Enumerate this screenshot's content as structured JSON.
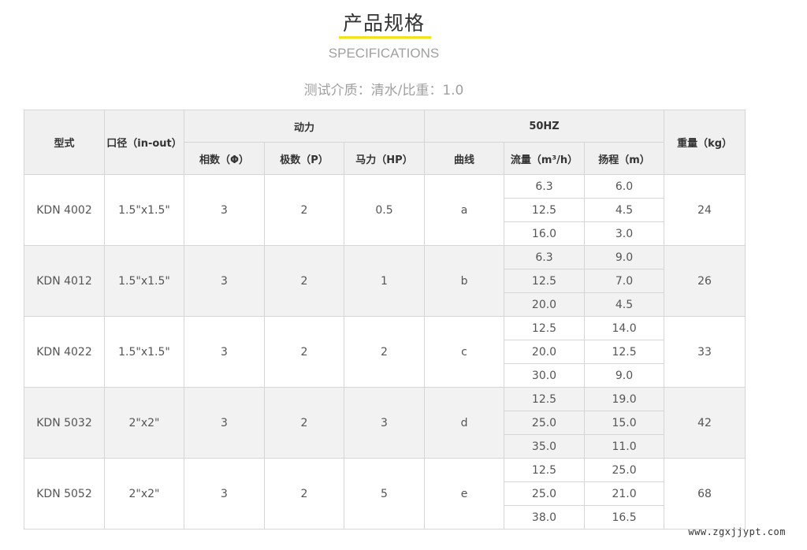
{
  "header": {
    "title": "产品规格",
    "subtitle": "SPECIFICATIONS",
    "test_medium": "测试介质：清水/比重：1.0",
    "underline_color": "#f4e11e"
  },
  "table": {
    "headers": {
      "model": "型式",
      "port": "口径（in-out）",
      "power": "动力",
      "phase": "相数（Φ）",
      "poles": "极数（P）",
      "hp": "马力（HP）",
      "freq": "50HZ",
      "curve": "曲线",
      "flow": "流量（m³/h）",
      "head": "扬程（m）",
      "weight": "重量（kg）"
    },
    "rows": [
      {
        "model": "KDN 4002",
        "port": "1.5\"x1.5\"",
        "phase": "3",
        "poles": "2",
        "hp": "0.5",
        "curve": "a",
        "points": [
          {
            "flow": "6.3",
            "head": "6.0"
          },
          {
            "flow": "12.5",
            "head": "4.5"
          },
          {
            "flow": "16.0",
            "head": "3.0"
          }
        ],
        "weight": "24"
      },
      {
        "model": "KDN 4012",
        "port": "1.5\"x1.5\"",
        "phase": "3",
        "poles": "2",
        "hp": "1",
        "curve": "b",
        "points": [
          {
            "flow": "6.3",
            "head": "9.0"
          },
          {
            "flow": "12.5",
            "head": "7.0"
          },
          {
            "flow": "20.0",
            "head": "4.5"
          }
        ],
        "weight": "26"
      },
      {
        "model": "KDN 4022",
        "port": "1.5\"x1.5\"",
        "phase": "3",
        "poles": "2",
        "hp": "2",
        "curve": "c",
        "points": [
          {
            "flow": "12.5",
            "head": "14.0"
          },
          {
            "flow": "20.0",
            "head": "12.5"
          },
          {
            "flow": "30.0",
            "head": "9.0"
          }
        ],
        "weight": "33"
      },
      {
        "model": "KDN 5032",
        "port": "2\"x2\"",
        "phase": "3",
        "poles": "2",
        "hp": "3",
        "curve": "d",
        "points": [
          {
            "flow": "12.5",
            "head": "19.0"
          },
          {
            "flow": "25.0",
            "head": "15.0"
          },
          {
            "flow": "35.0",
            "head": "11.0"
          }
        ],
        "weight": "42"
      },
      {
        "model": "KDN 5052",
        "port": "2\"x2\"",
        "phase": "3",
        "poles": "2",
        "hp": "5",
        "curve": "e",
        "points": [
          {
            "flow": "12.5",
            "head": "25.0"
          },
          {
            "flow": "25.0",
            "head": "21.0"
          },
          {
            "flow": "38.0",
            "head": "16.5"
          }
        ],
        "weight": "68"
      }
    ]
  },
  "watermark": "www.zgxjjypt.com"
}
